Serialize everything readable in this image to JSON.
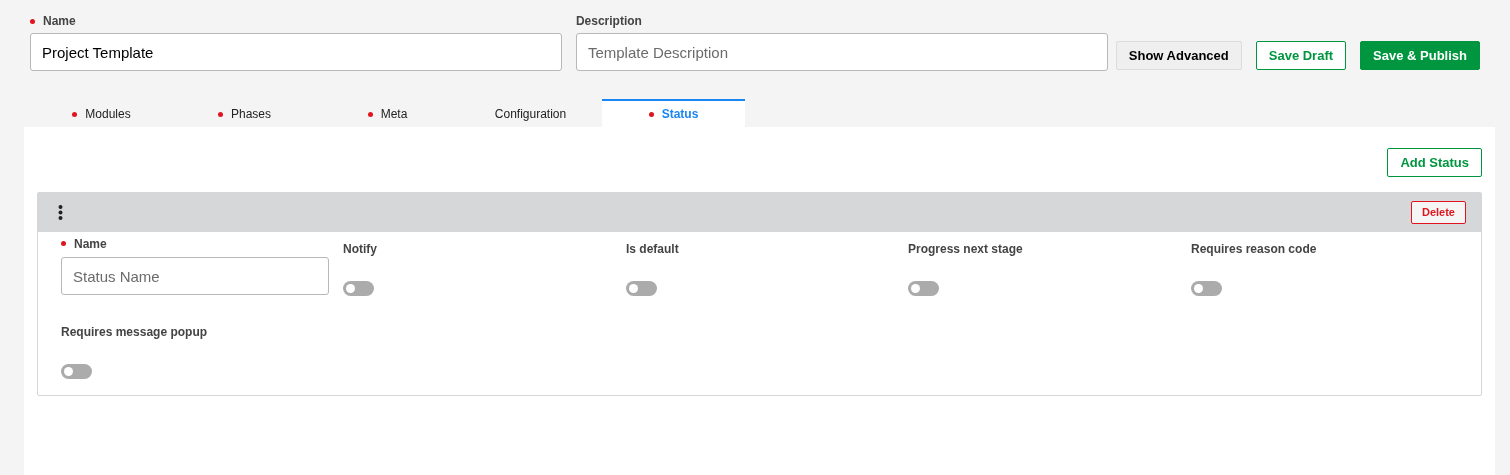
{
  "header": {
    "name_field": {
      "label": "Name",
      "required": true,
      "value": "Project Template"
    },
    "description_field": {
      "label": "Description",
      "required": false,
      "placeholder": "Template Description"
    },
    "buttons": [
      {
        "label": "Show Advanced",
        "kind": "neutral"
      },
      {
        "label": "Save Draft",
        "kind": "outline"
      },
      {
        "label": "Save & Publish",
        "kind": "primary"
      }
    ]
  },
  "tabs": [
    {
      "label": "Modules",
      "required": true,
      "selected": false
    },
    {
      "label": "Phases",
      "required": true,
      "selected": false
    },
    {
      "label": "Meta",
      "required": true,
      "selected": false
    },
    {
      "label": "Configuration",
      "required": false,
      "selected": false
    },
    {
      "label": "Status",
      "required": true,
      "selected": true
    }
  ],
  "add_button": {
    "label": "Add Status"
  },
  "status_cards": [
    {
      "delete_label": "Delete",
      "name_field": {
        "label": "Name",
        "required": true,
        "placeholder": "Status Name"
      },
      "toggles": [
        {
          "label": "Notify",
          "on": false
        },
        {
          "label": "Is default",
          "on": false
        },
        {
          "label": "Progress next stage",
          "on": false
        },
        {
          "label": "Requires reason code",
          "on": false
        },
        {
          "label": "Requires message popup",
          "on": false
        }
      ]
    }
  ]
}
